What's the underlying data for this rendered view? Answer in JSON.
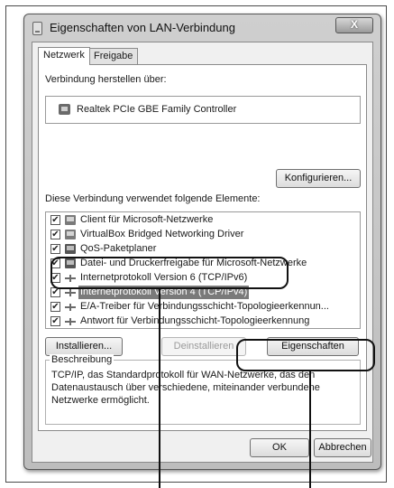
{
  "window": {
    "title": "Eigenschaften von LAN-Verbindung",
    "close_label": "X"
  },
  "tabs": [
    {
      "label": "Netzwerk",
      "active": true
    },
    {
      "label": "Freigabe",
      "active": false
    }
  ],
  "connection": {
    "label": "Verbindung herstellen über:",
    "adapter": "Realtek PCIe GBE Family Controller",
    "configure_button": "Konfigurieren..."
  },
  "elements": {
    "label": "Diese Verbindung verwendet folgende Elemente:",
    "items": [
      {
        "label": "Client für Microsoft-Netzwerke",
        "checked": true,
        "icon": "client-icon"
      },
      {
        "label": "VirtualBox Bridged Networking Driver",
        "checked": true,
        "icon": "client-icon"
      },
      {
        "label": "QoS-Paketplaner",
        "checked": true,
        "icon": "computer-icon"
      },
      {
        "label": "Datei- und Druckerfreigabe für Microsoft-Netzwerke",
        "checked": true,
        "icon": "computer-icon"
      },
      {
        "label": "Internetprotokoll Version 6 (TCP/IPv6)",
        "checked": true,
        "icon": "protocol-icon"
      },
      {
        "label": "Internetprotokoll Version 4 (TCP/IPv4)",
        "checked": true,
        "icon": "protocol-icon",
        "selected": true
      },
      {
        "label": "E/A-Treiber für Verbindungsschicht-Topologieerkennun...",
        "checked": true,
        "icon": "protocol-icon"
      },
      {
        "label": "Antwort für Verbindungsschicht-Topologieerkennung",
        "checked": true,
        "icon": "protocol-icon"
      }
    ]
  },
  "actions": {
    "install": "Installieren...",
    "uninstall": "Deinstallieren",
    "properties": "Eigenschaften"
  },
  "description": {
    "legend": "Beschreibung",
    "text": "TCP/IP, das Standardprotokoll für WAN-Netzwerke, das den Datenaustausch über verschiedene, miteinander verbundene Netzwerke ermöglicht."
  },
  "footer": {
    "ok": "OK",
    "cancel": "Abbrechen"
  },
  "colors": {
    "selection": "#7a7a7a",
    "callout": "#111111"
  }
}
